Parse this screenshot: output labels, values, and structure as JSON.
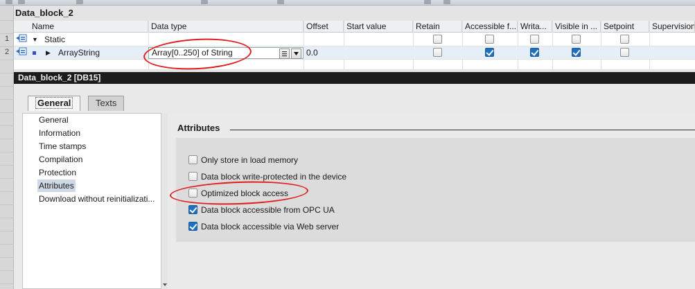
{
  "db_title": "Data_block_2",
  "table": {
    "headers": [
      "Name",
      "Data type",
      "Offset",
      "Start value",
      "Retain",
      "Accessible f...",
      "Writa...",
      "Visible in ...",
      "Setpoint",
      "Supervision"
    ],
    "rows": [
      {
        "num": "1",
        "expander": "▼",
        "name": "Static",
        "data_type": "",
        "offset": "",
        "retain": false,
        "accessible": false,
        "writable": false,
        "visible": false,
        "setpoint": false
      },
      {
        "num": "2",
        "expander": "▶",
        "name": "ArrayString",
        "data_type": "Array[0..250] of String",
        "offset": "0.0",
        "retain": false,
        "accessible": true,
        "writable": true,
        "visible": true,
        "setpoint": false
      }
    ]
  },
  "panel": {
    "title": "Data_block_2 [DB15]",
    "tabs": [
      {
        "label": "General",
        "active": true
      },
      {
        "label": "Texts",
        "active": false
      }
    ],
    "nav": [
      "General",
      "Information",
      "Time stamps",
      "Compilation",
      "Protection",
      "Attributes",
      "Download without reinitializati..."
    ],
    "nav_selected": 5,
    "section_title": "Attributes",
    "attributes": [
      {
        "label": "Only store in load memory",
        "checked": false
      },
      {
        "label": "Data block write-protected in the device",
        "checked": false
      },
      {
        "label": "Optimized block access",
        "checked": false
      },
      {
        "label": "Data block accessible from OPC UA",
        "checked": true
      },
      {
        "label": "Data block accessible via Web server",
        "checked": true
      }
    ]
  },
  "colors": {
    "accent": "#1f6fbf",
    "annotation": "#e21c1c",
    "panel_title_bg": "#1c1c1c"
  },
  "icons": {
    "row_interface": "interface-icon",
    "row_bullet": "member-bullet-icon",
    "datatype_browse": "list-browse-icon",
    "datatype_dropdown": "chevron-down-icon"
  }
}
